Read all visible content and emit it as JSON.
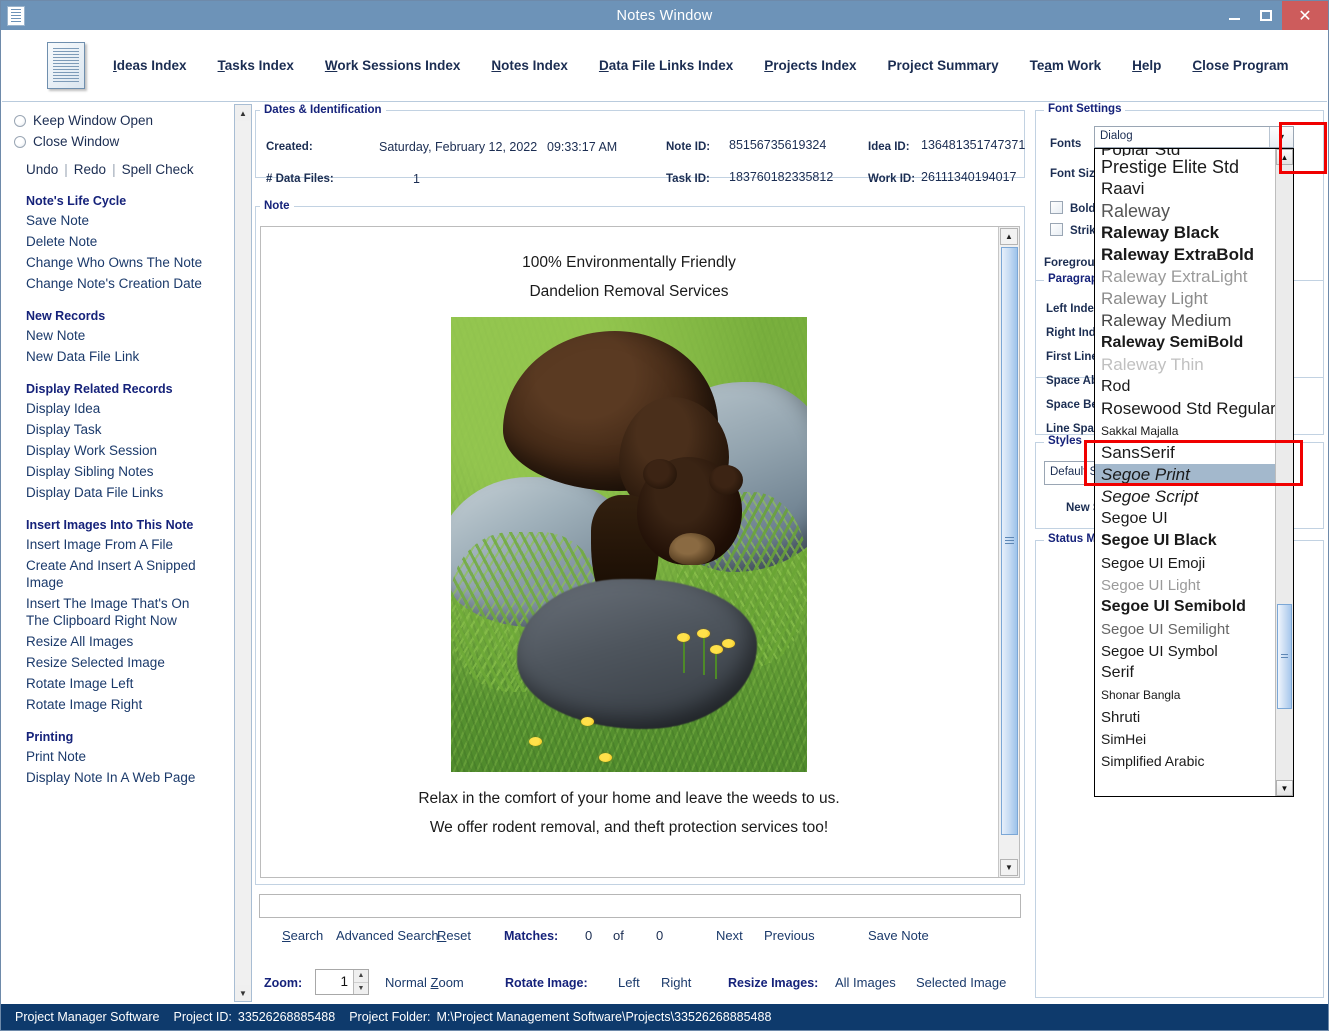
{
  "window": {
    "title": "Notes Window",
    "icon": "document-icon",
    "minimize": "minimize-icon",
    "maximize": "maximize-icon",
    "close": "close-icon"
  },
  "menu": {
    "items": [
      {
        "label": "Ideas Index",
        "accel": "I"
      },
      {
        "label": "Tasks Index",
        "accel": "T"
      },
      {
        "label": "Work Sessions Index",
        "accel": "W"
      },
      {
        "label": "Notes Index",
        "accel": "N"
      },
      {
        "label": "Data File Links Index",
        "accel": "D"
      },
      {
        "label": "Projects Index",
        "accel": "P"
      },
      {
        "label": "Project Summary",
        "accel": "j"
      },
      {
        "label": "Team Work",
        "accel": "a"
      },
      {
        "label": "Help",
        "accel": "H"
      },
      {
        "label": "Close Program",
        "accel": "C"
      }
    ]
  },
  "sidebar": {
    "radios": [
      {
        "label": "Keep Window Open",
        "checked": false
      },
      {
        "label": "Close Window",
        "checked": false
      }
    ],
    "edit_actions": [
      "Undo",
      "Redo",
      "Spell Check"
    ],
    "sections": [
      {
        "heading": "Note's Life Cycle",
        "links": [
          "Save Note",
          "Delete Note",
          "Change Who Owns The Note",
          "Change Note's Creation Date"
        ]
      },
      {
        "heading": "New Records",
        "links": [
          "New Note",
          "New Data File Link"
        ]
      },
      {
        "heading": "Display Related Records",
        "links": [
          "Display Idea",
          "Display Task",
          "Display Work Session",
          "Display Sibling Notes",
          "Display Data File Links"
        ]
      },
      {
        "heading": "Insert Images Into This Note",
        "links": [
          "Insert Image From A File",
          "Create And Insert A Snipped Image",
          "Insert The Image That's On The Clipboard Right Now",
          "Resize All Images",
          "Resize Selected Image",
          "Rotate Image Left",
          "Rotate Image Right"
        ]
      },
      {
        "heading": "Printing",
        "links": [
          "Print Note",
          "Display Note In A Web Page"
        ]
      }
    ]
  },
  "dates": {
    "legend": "Dates & Identification",
    "created_label": "Created:",
    "created_value": "Saturday, February 12, 2022",
    "created_time": "09:33:17 AM",
    "datafiles_label": "# Data Files:",
    "datafiles_value": "1",
    "note_id_label": "Note ID:",
    "note_id_value": "85156735619324",
    "idea_id_label": "Idea ID:",
    "idea_id_value": "136481351747371",
    "task_id_label": "Task ID:",
    "task_id_value": "183760182335812",
    "work_id_label": "Work ID:",
    "work_id_value": "26111340194017"
  },
  "note": {
    "legend": "Note",
    "line1": "100% Environmentally Friendly",
    "line2": "Dandelion Removal Services",
    "image_alt": "Black bear on mossy rocks beside dandelions in green grass",
    "line3": "Relax in the comfort of your home and leave the weeds to us.",
    "line4": "We offer rodent removal, and theft protection services too!"
  },
  "toolbar": {
    "search_value": "",
    "search_placeholder": "",
    "search": "Search",
    "advanced_search": "Advanced Search",
    "reset": "Reset",
    "matches_label": "Matches:",
    "matches_current": "0",
    "matches_of": "of",
    "matches_total": "0",
    "next": "Next",
    "previous": "Previous",
    "save_note": "Save Note",
    "zoom_label": "Zoom:",
    "zoom_value": "1",
    "normal_zoom": "Normal Zoom",
    "rotate_label": "Rotate Image:",
    "rotate_left": "Left",
    "rotate_right": "Right",
    "resize_label": "Resize Images:",
    "resize_all": "All Images",
    "resize_selected": "Selected Image"
  },
  "font_settings": {
    "legend": "Font Settings",
    "fonts_label": "Fonts",
    "font_size_label": "Font Size",
    "bold_label": "Bold",
    "strikethrough_label": "Strikethr",
    "foreground_label": "Foreground",
    "selected_font": "Dialog",
    "dropdown_open": true,
    "dropdown_items": [
      {
        "name": "Poplar Std",
        "style": "normal",
        "weight": "normal",
        "size": 17,
        "clipped": true
      },
      {
        "name": "Prestige Elite Std",
        "style": "normal",
        "weight": "normal",
        "size": 18
      },
      {
        "name": "Raavi",
        "style": "normal",
        "weight": "normal",
        "size": 17
      },
      {
        "name": "Raleway",
        "style": "normal",
        "weight": "normal",
        "size": 18,
        "color": "#555555"
      },
      {
        "name": "Raleway Black",
        "style": "normal",
        "weight": "bold",
        "size": 17
      },
      {
        "name": "Raleway ExtraBold",
        "style": "normal",
        "weight": "bold",
        "size": 17
      },
      {
        "name": "Raleway ExtraLight",
        "style": "normal",
        "weight": "normal",
        "size": 17,
        "color": "#9a9a9a"
      },
      {
        "name": "Raleway Light",
        "style": "normal",
        "weight": "normal",
        "size": 17,
        "color": "#8a8a8a"
      },
      {
        "name": "Raleway Medium",
        "style": "normal",
        "weight": "normal",
        "size": 17,
        "color": "#444444"
      },
      {
        "name": "Raleway SemiBold",
        "style": "normal",
        "weight": "bold",
        "size": 16
      },
      {
        "name": "Raleway Thin",
        "style": "normal",
        "weight": "normal",
        "size": 17,
        "color": "#c0c0c0"
      },
      {
        "name": "Rod",
        "style": "normal",
        "weight": "normal",
        "size": 16
      },
      {
        "name": "Rosewood Std Regular",
        "style": "normal",
        "weight": "normal",
        "size": 17
      },
      {
        "name": "Sakkal Majalla",
        "style": "normal",
        "weight": "normal",
        "size": 12
      },
      {
        "name": "SansSerif",
        "style": "normal",
        "weight": "normal",
        "size": 17
      },
      {
        "name": "Segoe Print",
        "style": "italic",
        "weight": "normal",
        "size": 17,
        "selected": true
      },
      {
        "name": "Segoe Script",
        "style": "italic",
        "weight": "normal",
        "size": 17
      },
      {
        "name": "Segoe UI",
        "style": "normal",
        "weight": "normal",
        "size": 16
      },
      {
        "name": "Segoe UI Black",
        "style": "normal",
        "weight": "bold",
        "size": 16
      },
      {
        "name": "Segoe UI Emoji",
        "style": "normal",
        "weight": "normal",
        "size": 15
      },
      {
        "name": "Segoe UI Light",
        "style": "normal",
        "weight": "normal",
        "size": 15,
        "color": "#9a9a9a"
      },
      {
        "name": "Segoe UI Semibold",
        "style": "normal",
        "weight": "bold",
        "size": 16
      },
      {
        "name": "Segoe UI Semilight",
        "style": "normal",
        "weight": "normal",
        "size": 15,
        "color": "#666666"
      },
      {
        "name": "Segoe UI Symbol",
        "style": "normal",
        "weight": "normal",
        "size": 15
      },
      {
        "name": "Serif",
        "style": "normal",
        "weight": "normal",
        "size": 16
      },
      {
        "name": "Shonar Bangla",
        "style": "normal",
        "weight": "normal",
        "size": 12
      },
      {
        "name": "Shruti",
        "style": "normal",
        "weight": "normal",
        "size": 15
      },
      {
        "name": "SimHei",
        "style": "normal",
        "weight": "normal",
        "size": 14
      },
      {
        "name": "Simplified Arabic",
        "style": "normal",
        "weight": "normal",
        "size": 14
      }
    ]
  },
  "paragraph": {
    "legend": "Paragraph",
    "labels": [
      "Left Indent",
      "Right Indent",
      "First Line Ind",
      "Space Abov",
      "Space Belov",
      "Line Spacin"
    ]
  },
  "styles": {
    "legend": "Styles",
    "default_style": "Default Styl",
    "new_style": "New Style"
  },
  "status_messages": {
    "legend": "Status Mes"
  },
  "statusbar": {
    "app_name": "Project Manager Software",
    "project_id_label": "Project ID:",
    "project_id": "33526268885488",
    "project_folder_label": "Project Folder:",
    "project_folder": "M:\\Project Management Software\\Projects\\33526268885488"
  },
  "annotations": {
    "highlight_color": "#f00000",
    "boxes": [
      "font-dropdown-arrow-highlight",
      "selected-font-item-highlight"
    ]
  }
}
